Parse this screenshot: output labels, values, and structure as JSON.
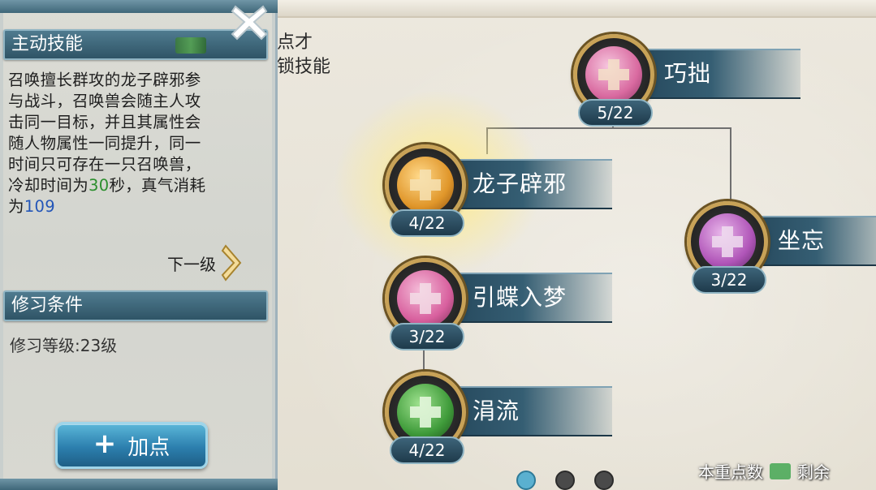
{
  "panel": {
    "skill_type_title": "主动技能",
    "description_lines": [
      "召唤擅长群攻的龙子辟邪参",
      "与战斗，召唤兽会随主人攻",
      "击同一目标，并且其属性会",
      "随人物属性一同提升，同一",
      "时间只可存在一只召唤兽，"
    ],
    "description_cooldown_prefix": "冷却时间为",
    "description_cooldown_value": "30",
    "description_cooldown_suffix": "秒，真气消耗",
    "description_cost_prefix": "为",
    "description_cost_value": "109",
    "next_level_label": "下一级",
    "requirement_title": "修习条件",
    "requirement_text": "修习等级:23级",
    "add_button_label": "加点"
  },
  "behind_text": [
    "点才",
    "锁技能"
  ],
  "skills": [
    {
      "name": "巧拙",
      "level": "5/22",
      "icon": "pink-cross-skill-icon",
      "color": "#d96aa0"
    },
    {
      "name": "龙子辟邪",
      "level": "4/22",
      "icon": "gold-cross-skill-icon",
      "color": "#e0962a"
    },
    {
      "name": "坐忘",
      "level": "3/22",
      "icon": "purple-cross-skill-icon",
      "color": "#b055b8"
    },
    {
      "name": "引蝶入梦",
      "level": "3/22",
      "icon": "pink-cross-skill-icon",
      "color": "#d8609e"
    },
    {
      "name": "涓流",
      "level": "4/22",
      "icon": "green-cross-skill-icon",
      "color": "#3f9b3a"
    }
  ],
  "pager": {
    "pages": 3,
    "active": 0
  },
  "status": {
    "prefix": "本重点数",
    "remaining": "剩余"
  }
}
